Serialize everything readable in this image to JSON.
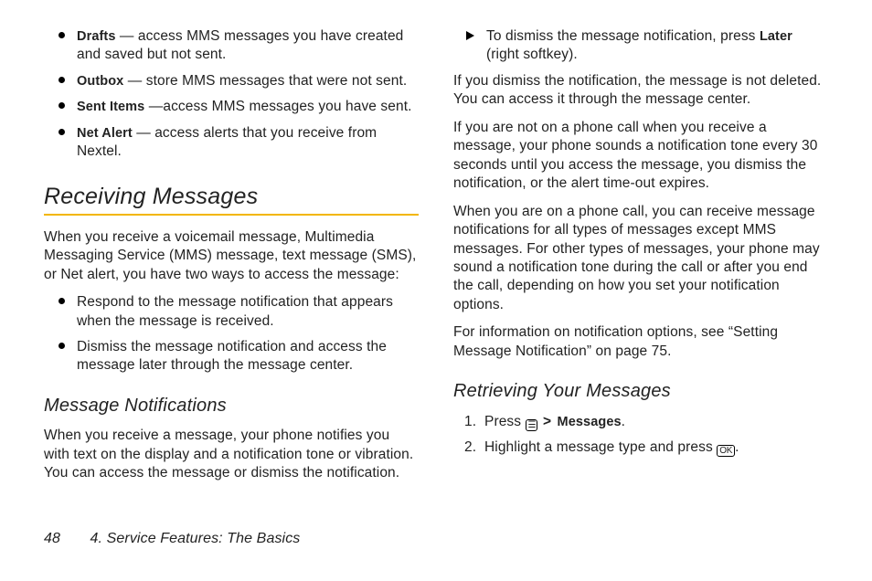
{
  "left": {
    "folders": [
      {
        "term": "Drafts",
        "desc": " — access MMS messages you have created and saved but not sent."
      },
      {
        "term": "Outbox",
        "desc": " — store MMS messages that were not sent."
      },
      {
        "term": "Sent Items",
        "desc": " —access MMS messages you have sent."
      },
      {
        "term": "Net Alert",
        "desc": " — access alerts that you receive from Nextel."
      }
    ],
    "h_receiving": "Receiving Messages",
    "p_receiving_intro": "When you receive a voicemail message, Multimedia Messaging Service (MMS) message, text message (SMS), or Net alert, you have two ways to access the message:",
    "receiving_options": [
      "Respond to the message notification that appears when the message is received.",
      "Dismiss the message notification and access the message later through the message center."
    ],
    "h_msg_notif": "Message Notifications",
    "p_msg_notif": "When you receive a message, your phone notifies you with text on the display and a notification tone or vibration. You can access the message or dismiss the notification."
  },
  "right": {
    "dismiss_pre": "To dismiss the message notification, press ",
    "dismiss_bold": "Later",
    "dismiss_post": " (right softkey).",
    "p_if_dismiss": "If you dismiss the notification, the message is not deleted. You can access it through the message center.",
    "p_not_on_call": "If you are not on a phone call when you receive a message, your phone sounds a notification tone every 30 seconds until you access the message, you dismiss the notification, or the alert time-out expires.",
    "p_on_call": "When you are on a phone call, you can receive message notifications for all types of messages except MMS messages. For other types of messages, your phone may sound a notification tone during the call or after you end the call, depending on how you set your notification options.",
    "p_see_info": "For information on notification options, see “Setting Message Notification” on page 75.",
    "h_retrieving": "Retrieving Your Messages",
    "step1_pre": "Press ",
    "step1_menu_icon": "☰",
    "step1_chev": ">",
    "step1_bold": "Messages",
    "step1_post": ".",
    "step2_pre": "Highlight a message type and press ",
    "step2_ok_icon": "OK",
    "step2_post": "."
  },
  "footer": {
    "page_num": "48",
    "chapter": "4. Service Features: The Basics"
  }
}
